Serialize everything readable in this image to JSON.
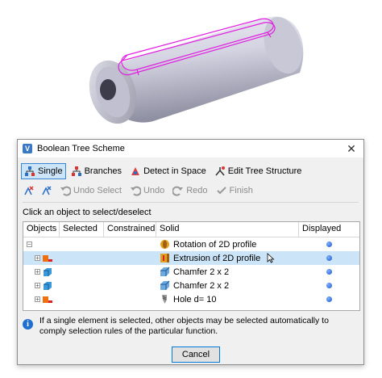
{
  "dialog": {
    "title": "Boolean Tree Scheme",
    "close_label": "✕",
    "toolbar_modes": [
      {
        "label": "Single",
        "icon": "single-tree-icon",
        "active": true
      },
      {
        "label": "Branches",
        "icon": "branches-tree-icon",
        "active": false
      },
      {
        "label": "Detect in Space",
        "icon": "detect-in-space-icon",
        "active": false
      },
      {
        "label": "Edit Tree Structure",
        "icon": "edit-tree-icon",
        "active": false
      }
    ],
    "toolbar_actions": [
      {
        "label": "Undo Select",
        "icon": "undo-select-icon"
      },
      {
        "label": "Undo",
        "icon": "undo-icon"
      },
      {
        "label": "Redo",
        "icon": "redo-icon"
      },
      {
        "label": "Finish",
        "icon": "finish-icon"
      }
    ],
    "hint": "Click an object to select/deselect",
    "columns": [
      "Objects",
      "Selected",
      "Constrained",
      "Solid",
      "Displayed"
    ],
    "rows": [
      {
        "solid": "Rotation of 2D profile",
        "icon": "rotation-icon",
        "displayed": true,
        "selected": false
      },
      {
        "solid": "Extrusion of 2D profile",
        "icon": "extrusion-icon",
        "displayed": true,
        "selected": true
      },
      {
        "solid": "Chamfer 2 x 2",
        "icon": "chamfer-icon",
        "displayed": true,
        "selected": false
      },
      {
        "solid": "Chamfer 2 x 2",
        "icon": "chamfer-icon",
        "displayed": true,
        "selected": false
      },
      {
        "solid": "Hole d= 10",
        "icon": "hole-icon",
        "displayed": true,
        "selected": false
      }
    ],
    "info": "If a single element is selected, other objects may be selected automatically to comply selection rules of the particular function.",
    "cancel_label": "Cancel"
  },
  "colors": {
    "accent": "#cce4f7",
    "highlight": "#e020e0",
    "model": "#d0d0de"
  }
}
